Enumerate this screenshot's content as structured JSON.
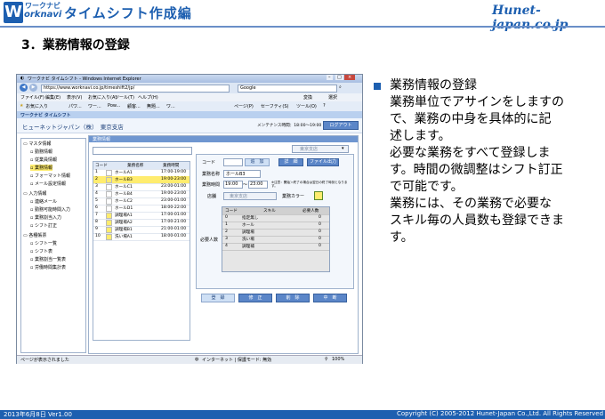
{
  "header": {
    "logo_letter": "W",
    "logo_top": "ワークナビ",
    "logo_sub": "orknavi",
    "logo_title": "タイムシフト作成編",
    "brand": "Hunet-japan.co.jp"
  },
  "section_title": "3．業務情報の登録",
  "browser": {
    "window_title": "ワークナビ タイムシフト - Windows Internet Explorer",
    "address": "https://www.worknavi.co.jp/timeshift2/jp/",
    "search_engine": "Google",
    "menu_items": [
      "ファイル(F)",
      "編集(E)",
      "表示(V)",
      "お気に入り(A)",
      "ツール(T)",
      "ヘルプ(H)"
    ],
    "menu_right": [
      "変換",
      "選択"
    ],
    "favorites_label": "お気に入り",
    "tab_labels": [
      "パワ...",
      "ワー...",
      "Pow...",
      "顧客...",
      "無題...",
      "ワ..."
    ],
    "tools_right": [
      "ページ(P)",
      "セーフティ(S)",
      "ツール(O)"
    ],
    "status_left": "ページが表示されました",
    "status_zone": "インターネット | 保護モード: 無効",
    "status_zoom": "100%"
  },
  "app": {
    "app_name": "ワークナビ タイムシフト",
    "company": "ヒューネットジャパン（株）　東京支店",
    "maintenance": "メンテナンス時間：18:00～19:00",
    "logout": "ログアウト",
    "tree": [
      {
        "label": "マスタ情報",
        "level": 0
      },
      {
        "label": "勤務情報",
        "level": 1
      },
      {
        "label": "従業員情報",
        "level": 1
      },
      {
        "label": "業務情報",
        "level": 1,
        "selected": true
      },
      {
        "label": "フォーマット情報",
        "level": 1
      },
      {
        "label": "メール設定情報",
        "level": 1
      },
      {
        "label": "入力情報",
        "level": 0
      },
      {
        "label": "連絡メール",
        "level": 1
      },
      {
        "label": "勤務可能時間入力",
        "level": 1
      },
      {
        "label": "業務割当入力",
        "level": 1
      },
      {
        "label": "シフト訂正",
        "level": 1
      },
      {
        "label": "各種帳票",
        "level": 0
      },
      {
        "label": "シフト一覧",
        "level": 1
      },
      {
        "label": "シフト表",
        "level": 1
      },
      {
        "label": "業務割当一覧表",
        "level": 1
      },
      {
        "label": "労働時間集計表",
        "level": 1
      }
    ],
    "panel_title": "業務情報",
    "table": {
      "headers": [
        "コード",
        "業務名称",
        "業務時間"
      ],
      "rows": [
        {
          "code": "1",
          "name": "ホールA1",
          "time": "17:00-19:00",
          "color": "#ffffff"
        },
        {
          "code": "2",
          "name": "ホールB3",
          "time": "19:00-23:00",
          "color": "#ffec6e",
          "selected": true
        },
        {
          "code": "3",
          "name": "ホールC1",
          "time": "23:00-01:00",
          "color": "#ffffff"
        },
        {
          "code": "4",
          "name": "ホールB4",
          "time": "19:00-23:00",
          "color": "#ffffff"
        },
        {
          "code": "5",
          "name": "ホールC2",
          "time": "23:00-01:00",
          "color": "#ffffff"
        },
        {
          "code": "6",
          "name": "ホールD1",
          "time": "18:00-22:00",
          "color": "#ffffff"
        },
        {
          "code": "7",
          "name": "調理場A1",
          "time": "17:00-01:00",
          "color": "#ffec6e"
        },
        {
          "code": "8",
          "name": "調理場A2",
          "time": "17:00-21:00",
          "color": "#ffec6e"
        },
        {
          "code": "9",
          "name": "調理場B1",
          "time": "21:00-01:00",
          "color": "#ffec6e"
        },
        {
          "code": "10",
          "name": "洗い場A1",
          "time": "18:00-01:00",
          "color": "#ffec6e"
        }
      ]
    },
    "form": {
      "store_select": "東京支店",
      "code_label": "コード",
      "add_button": "追　加",
      "detail_button": "詳　細",
      "file_button": "ファイル出力",
      "name_label": "業務名称",
      "name_value": "ホールB3",
      "time_label": "業務時間",
      "time_from": "19:00",
      "time_to": "23:00",
      "note": "※注意：開始＞終了の場合は翌日の終了時刻となります。",
      "store_label": "店舗",
      "store_value": "東京支店",
      "color_label": "業務カラー",
      "required_label": "必要人数",
      "grid_headers": [
        "コード",
        "スキル",
        "必要人数"
      ],
      "grid_rows": [
        {
          "code": "0",
          "skill": "指定無し",
          "count": "0"
        },
        {
          "code": "1",
          "skill": "ホール",
          "count": "0"
        },
        {
          "code": "2",
          "skill": "調理場",
          "count": "0"
        },
        {
          "code": "3",
          "skill": "洗い場",
          "count": "0"
        },
        {
          "code": "4",
          "skill": "調理補",
          "count": "0"
        }
      ],
      "buttons": [
        "登　録",
        "修　正",
        "削　除",
        "中　断"
      ]
    }
  },
  "description": {
    "heading": "業務情報の登録",
    "lines": [
      "業務単位でアサインをしますの",
      "で、業務の中身を具体的に記",
      "述します。",
      "必要な業務をすべて登録しま",
      "す。時間の微調整はシフト訂正",
      "で可能です。",
      "業務には、その業務で必要な",
      "スキル毎の人員数も登録できま",
      "す。"
    ]
  },
  "footer": {
    "date": "2013年6月8日 Ver1.00",
    "copyright": "Copyright (C) 2005-2012 Hunet-Japan Co.,Ltd. All Rights Reserved"
  }
}
